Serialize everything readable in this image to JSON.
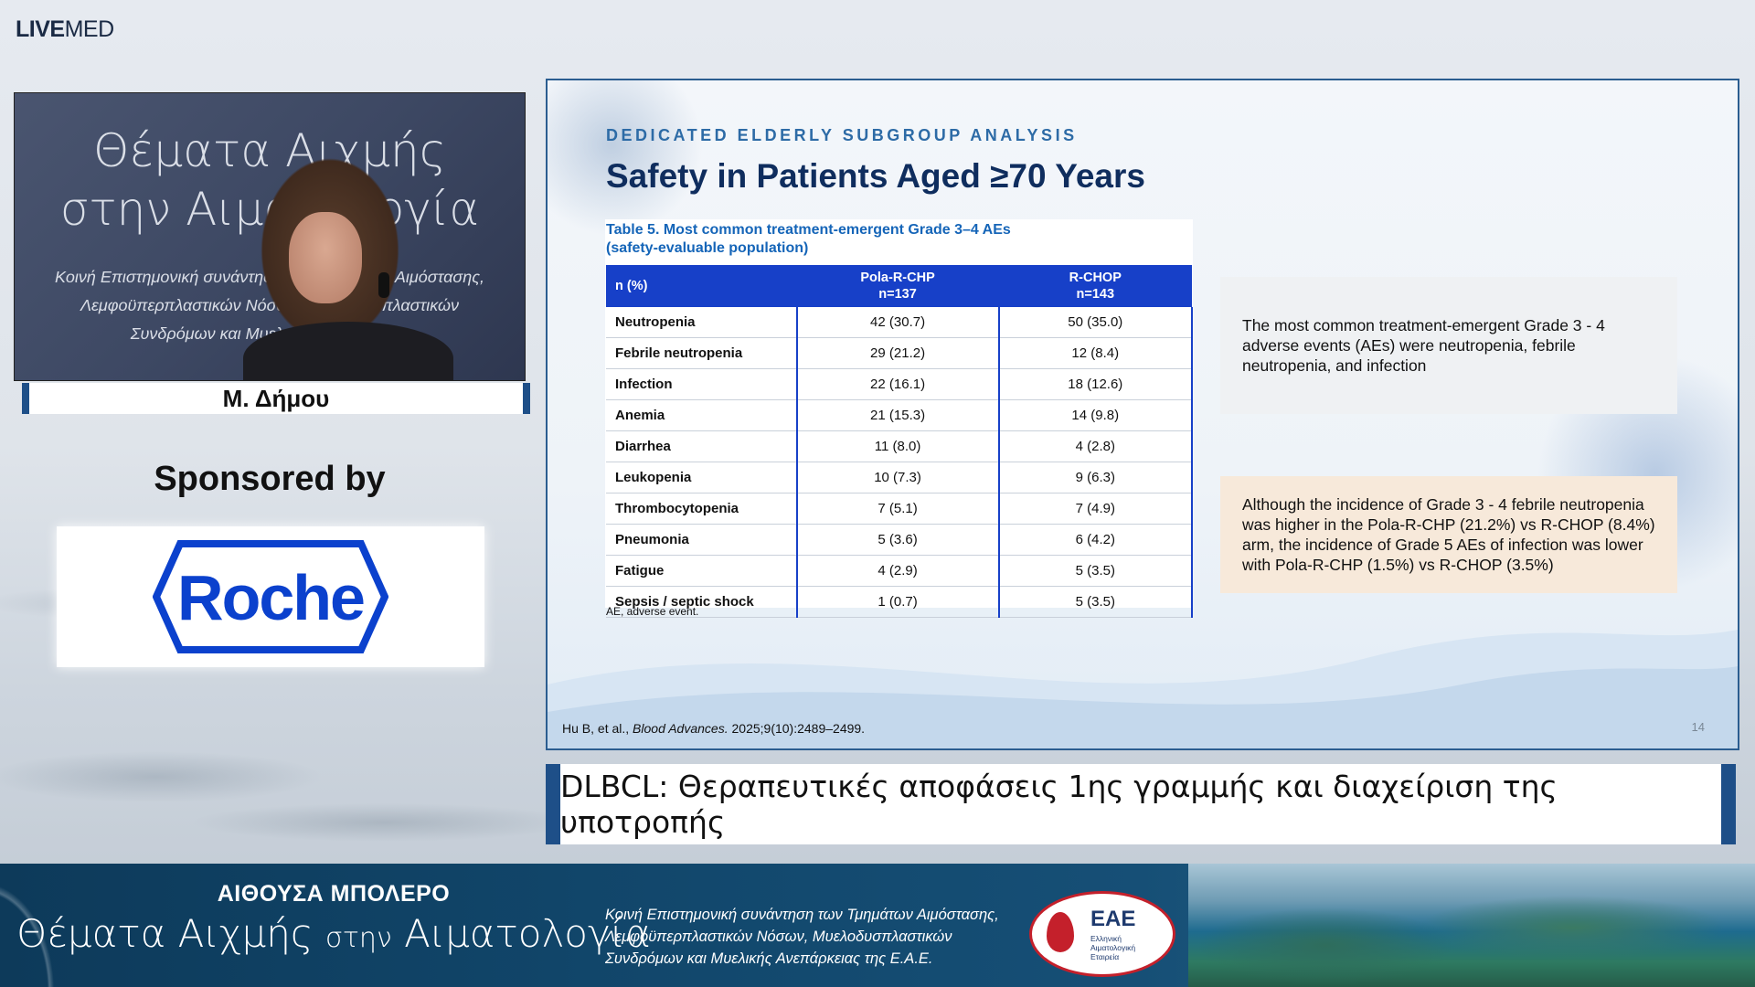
{
  "top_logo": {
    "bold": "LIVE",
    "regular": "MED"
  },
  "video": {
    "bg_line1": "Θέματα Αιχμής",
    "bg_line2": "στην Αιματολογία",
    "bg_line3": "Κοινή Επιστημονική συνάντηση των Τμημάτων Αιμόστασης,",
    "bg_line4": "Λεμφοϋπερπλαστικών Νόσων, Μυελοδυσπλαστικών",
    "bg_line5": "Συνδρόμων και Μυελικής Ανεπάρκειας"
  },
  "speaker_name": "Μ. Δήμου",
  "sponsor": {
    "label": "Sponsored by",
    "logo_text": "Roche",
    "logo_color": "#0b41cd"
  },
  "slide": {
    "subtitle": "DEDICATED ELDERLY SUBGROUP ANALYSIS",
    "title": "Safety in Patients Aged ≥70 Years",
    "table_caption_line1": "Table 5. Most common treatment-emergent Grade 3–4 AEs",
    "table_caption_line2": "(safety-evaluable population)",
    "table": {
      "headers": [
        {
          "line1": "n (%)",
          "line2": ""
        },
        {
          "line1": "Pola-R-CHP",
          "line2": "n=137"
        },
        {
          "line1": "R-CHOP",
          "line2": "n=143"
        }
      ],
      "rows": [
        [
          "Neutropenia",
          "42 (30.7)",
          "50 (35.0)"
        ],
        [
          "Febrile neutropenia",
          "29 (21.2)",
          "12 (8.4)"
        ],
        [
          "Infection",
          "22 (16.1)",
          "18 (12.6)"
        ],
        [
          "Anemia",
          "21 (15.3)",
          "14 (9.8)"
        ],
        [
          "Diarrhea",
          "11 (8.0)",
          "4 (2.8)"
        ],
        [
          "Leukopenia",
          "10 (7.3)",
          "9 (6.3)"
        ],
        [
          "Thrombocytopenia",
          "7 (5.1)",
          "7 (4.9)"
        ],
        [
          "Pneumonia",
          "5 (3.6)",
          "6 (4.2)"
        ],
        [
          "Fatigue",
          "4 (2.9)",
          "5 (3.5)"
        ],
        [
          "Sepsis / septic shock",
          "1 (0.7)",
          "5 (3.5)"
        ]
      ]
    },
    "footnote": "AE, adverse event.",
    "callout1": "The most common treatment-emergent Grade 3 - 4 adverse events (AEs) were neutropenia, febrile neutropenia, and infection",
    "callout2": "Although the incidence of Grade 3 - 4 febrile neutropenia was higher in the Pola-R-CHP (21.2%) vs R-CHOP (8.4%) arm, the incidence of Grade 5 AEs of infection was lower with Pola-R-CHP (1.5%) vs R-CHOP (3.5%)",
    "citation_authors": "Hu B, et al., ",
    "citation_journal": "Blood Advances.",
    "citation_rest": " 2025;9(10):2489–2499.",
    "page_number": "14"
  },
  "topic": "DLBCL: Θεραπευτικές αποφάσεις 1ης γραμμής και διαχείριση της υποτροπής",
  "banner": {
    "hall": "ΑΙΘΟΥΣΑ ΜΠΟΛΕΡΟ",
    "title_part1": "Θέματα Αιχμής ",
    "title_part2": "στην",
    "title_part3": " Αιματολογία",
    "desc_line1": "Κοινή Επιστημονική συνάντηση των Τμημάτων Αιμόστασης,",
    "desc_line2": "Λεμφοϋπερπλαστικών Νόσων, Μυελοδυσπλαστικών",
    "desc_line3": "Συνδρόμων και Μυελικής Ανεπάρκειας της Ε.Α.Ε.",
    "logo_abbr": "ΕΑΕ",
    "logo_line1": "Ελληνική",
    "logo_line2": "Αιματολογική",
    "logo_line3": "Εταιρεία"
  }
}
